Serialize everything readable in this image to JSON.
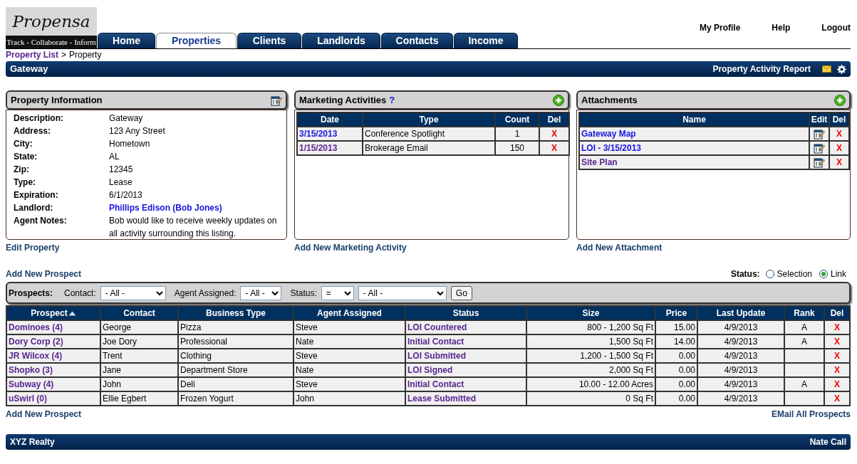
{
  "logo": {
    "name": "Propensa",
    "tagline": "Track - Collaborate - Inform"
  },
  "tabs": [
    {
      "label": "Home",
      "selected": false
    },
    {
      "label": "Properties",
      "selected": true
    },
    {
      "label": "Clients",
      "selected": false
    },
    {
      "label": "Landlords",
      "selected": false
    },
    {
      "label": "Contacts",
      "selected": false
    },
    {
      "label": "Income",
      "selected": false
    }
  ],
  "user_links": [
    "My Profile",
    "Help",
    "Logout"
  ],
  "breadcrumb": {
    "link": "Property List",
    "separator": ">",
    "current": "Property"
  },
  "title_bar": {
    "title": "Gateway",
    "report_link": "Property Activity Report"
  },
  "property_info": {
    "title": "Property Information",
    "fields": [
      {
        "label": "Description:",
        "value": "Gateway",
        "kind": "text"
      },
      {
        "label": "Address:",
        "value": "123 Any Street",
        "kind": "text"
      },
      {
        "label": "City:",
        "value": "Hometown",
        "kind": "text"
      },
      {
        "label": "State:",
        "value": "AL",
        "kind": "text"
      },
      {
        "label": "Zip:",
        "value": "12345",
        "kind": "text"
      },
      {
        "label": "Type:",
        "value": "Lease",
        "kind": "text"
      },
      {
        "label": "Expiration:",
        "value": "6/1/2013",
        "kind": "text"
      },
      {
        "label": "Landlord:",
        "value": "Phillips Edison (Bob Jones)",
        "kind": "link"
      },
      {
        "label": "Agent Notes:",
        "value": "Bob would like to receive weekly updates on all activity surrounding this listing.",
        "kind": "text"
      }
    ],
    "action": "Edit Property"
  },
  "marketing": {
    "title": "Marketing Activities",
    "help": "?",
    "columns": [
      "Date",
      "Type",
      "Count",
      "Del"
    ],
    "rows": [
      {
        "date": "3/15/2013",
        "visited": false,
        "type": "Conference Spotlight",
        "count": "1",
        "del": "X"
      },
      {
        "date": "1/15/2013",
        "visited": true,
        "type": "Brokerage Email",
        "count": "150",
        "del": "X"
      }
    ],
    "action": "Add New Marketing Activity"
  },
  "attachments": {
    "title": "Attachments",
    "columns": [
      "Name",
      "Edit",
      "Del"
    ],
    "rows": [
      {
        "name": "Gateway Map",
        "visited": false,
        "del": "X"
      },
      {
        "name": "LOI - 3/15/2013",
        "visited": false,
        "del": "X"
      },
      {
        "name": "Site Plan",
        "visited": true,
        "del": "X"
      }
    ],
    "action": "Add New Attachment"
  },
  "add_prospect_top": "Add New Prospect",
  "status_mode": {
    "label": "Status:",
    "options": [
      {
        "label": "Selection",
        "selected": false
      },
      {
        "label": "Link",
        "selected": true
      }
    ]
  },
  "filter": {
    "label": "Prospects:",
    "contact": {
      "label": "Contact:",
      "value": "- All -"
    },
    "agent": {
      "label": "Agent Assigned:",
      "value": "- All -"
    },
    "status": {
      "label": "Status:",
      "operator": "=",
      "value": "- All -"
    },
    "go": "Go"
  },
  "prospects": {
    "columns": [
      {
        "label": "Prospect",
        "sort_asc": true
      },
      {
        "label": "Contact",
        "sort_asc": false
      },
      {
        "label": "Business Type",
        "sort_asc": false
      },
      {
        "label": "Agent Assigned",
        "sort_asc": false
      },
      {
        "label": "Status",
        "sort_asc": false
      },
      {
        "label": "Size",
        "sort_asc": false
      },
      {
        "label": "Price",
        "sort_asc": false
      },
      {
        "label": "Last Update",
        "sort_asc": false
      },
      {
        "label": "Rank",
        "sort_asc": false
      },
      {
        "label": "Del",
        "sort_asc": false
      }
    ],
    "rows": [
      {
        "prospect": "Dominoes (4)",
        "contact": "George",
        "business_type": "Pizza",
        "agent": "Steve",
        "status": "LOI Countered",
        "size": "800 - 1,200 Sq Ft",
        "price": "15.00",
        "last_update": "4/9/2013",
        "rank": "A",
        "del": "X"
      },
      {
        "prospect": "Dory Corp (2)",
        "contact": "Joe Dory",
        "business_type": "Professional",
        "agent": "Nate",
        "status": "Initial Contact",
        "size": "1,500 Sq Ft",
        "price": "14.00",
        "last_update": "4/9/2013",
        "rank": "A",
        "del": "X"
      },
      {
        "prospect": "JR Wilcox (4)",
        "contact": "Trent",
        "business_type": "Clothing",
        "agent": "Steve",
        "status": "LOI Submitted",
        "size": "1,200 - 1,500 Sq Ft",
        "price": "0.00",
        "last_update": "4/9/2013",
        "del": "X"
      },
      {
        "prospect": "Shopko (3)",
        "contact": "Jane",
        "business_type": "Department Store",
        "agent": "Nate",
        "status": "LOI Signed",
        "size": "2,000 Sq Ft",
        "price": "0.00",
        "last_update": "4/9/2013",
        "del": "X"
      },
      {
        "prospect": "Subway (4)",
        "contact": "John",
        "business_type": "Deli",
        "agent": "Steve",
        "status": "Initial Contact",
        "size": "10.00 - 12.00 Acres",
        "price": "0.00",
        "last_update": "4/9/2013",
        "rank": "A",
        "del": "X"
      },
      {
        "prospect": "uSwirl (0)",
        "contact": "Ellie Egbert",
        "business_type": "Frozen Yogurt",
        "agent": "John",
        "status": "Lease Submitted",
        "size": "0 Sq Ft",
        "price": "0.00",
        "last_update": "4/9/2013",
        "del": "X"
      }
    ]
  },
  "add_prospect_bottom": "Add New Prospect",
  "email_all": "EMail All Prospects",
  "footer": {
    "left": "XYZ Realty",
    "right": "Nate Call"
  }
}
